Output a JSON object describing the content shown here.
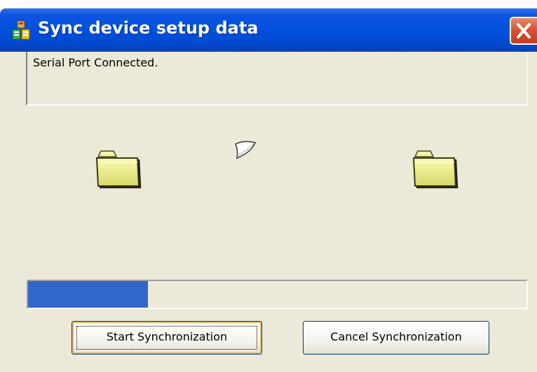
{
  "window": {
    "title": "Sync device setup data",
    "close_icon": "close-icon",
    "app_icon": "sync-app-icon"
  },
  "status": {
    "message": "Serial Port Connected."
  },
  "transfer": {
    "source_icon": "folder-icon",
    "destination_icon": "folder-icon",
    "moving_item_icon": "flying-paper-icon"
  },
  "progress": {
    "fraction": 0.24,
    "fill_color": "#3167cd"
  },
  "buttons": {
    "start_label": "Start Synchronization",
    "cancel_label": "Cancel Synchronization"
  },
  "colors": {
    "titlebar": "#0051dc",
    "close": "#d5512f",
    "dialog_bg": "#ece9d8"
  }
}
